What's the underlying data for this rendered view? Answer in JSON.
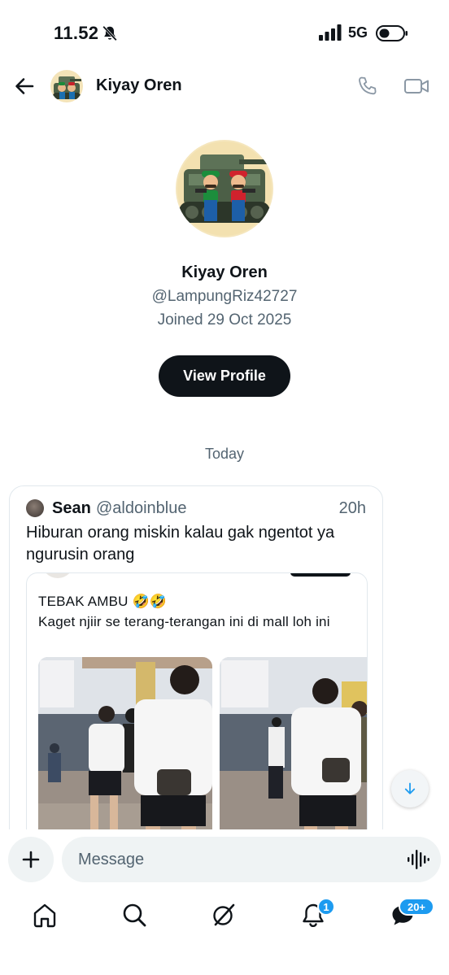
{
  "status_bar": {
    "time": "11.52",
    "network": "5G",
    "icons": [
      "bell-mute-icon",
      "signal-icon",
      "battery-icon"
    ]
  },
  "header": {
    "name": "Kiyay Oren",
    "icons": [
      "back-arrow-icon",
      "phone-icon",
      "video-icon"
    ]
  },
  "profile": {
    "name": "Kiyay Oren",
    "handle": "@LampungRiz42727",
    "joined": "Joined 29 Oct 2025",
    "view_profile_label": "View Profile"
  },
  "date_separator": "Today",
  "shared_post": {
    "author": "Sean",
    "handle": "@aldoinblue",
    "time": "20h",
    "text": "Hiburan orang miskin kalau gak ngentot ya ngurusin orang",
    "quoted": {
      "text_line1": "TEBAK AMBU 🤣🤣",
      "text_line2": "Kaget njiir se terang-terangan ini di mall loh ini"
    }
  },
  "composer": {
    "placeholder": "Message",
    "icons": [
      "plus-icon",
      "voice-wave-icon"
    ]
  },
  "bottom_nav": {
    "items": [
      "home-icon",
      "search-icon",
      "grok-icon",
      "notifications-icon",
      "messages-icon"
    ],
    "notifications_badge": "1",
    "messages_badge": "20+"
  },
  "colors": {
    "text_primary": "#0f1419",
    "text_secondary": "#536471",
    "accent": "#1d9bf0",
    "button_dark": "#0f1419",
    "surface": "#eff3f4"
  }
}
